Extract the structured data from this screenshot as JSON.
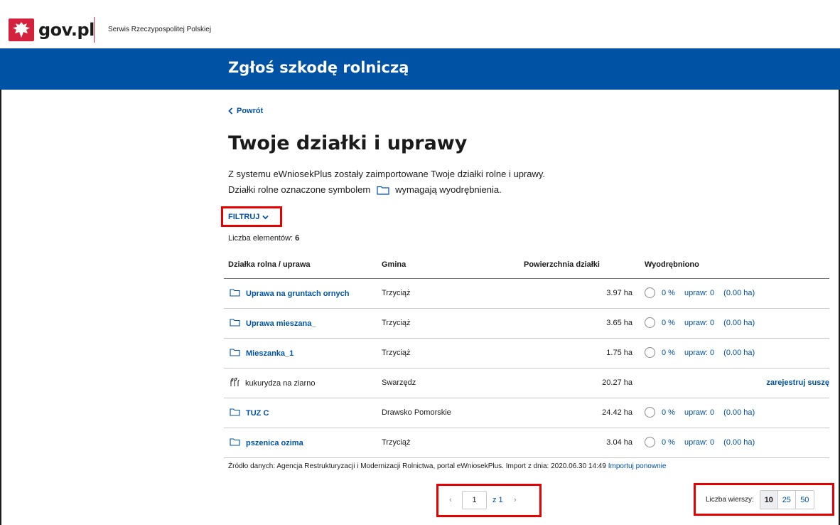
{
  "header": {
    "logo_text": "gov.pl",
    "service_name": "Serwis Rzeczypospolitej Polskiej",
    "banner_title": "Zgłoś szkodę rolniczą"
  },
  "page": {
    "back_label": "Powrót",
    "title": "Twoje działki i uprawy",
    "description_line1": "Z systemu eWniosekPlus zostały zaimportowane Twoje działki rolne i uprawy.",
    "description_line2_before": "Działki rolne oznaczone symbolem",
    "description_line2_after": "wymagają wyodrębnienia.",
    "filter_label": "FILTRUJ",
    "count_label": "Liczba elementów:",
    "count_value": "6"
  },
  "table": {
    "headers": [
      "Działka rolna / uprawa",
      "Gmina",
      "Powierzchnia działki",
      "Wyodrębniono"
    ],
    "rows": [
      {
        "name": "Uprawa na gruntach ornych",
        "icon": "folder-icon",
        "gmina": "Trzyciąż",
        "area": "3.97 ha",
        "pct": "0 %",
        "upraw": "upraw: 0",
        "ha": "(0.00 ha)"
      },
      {
        "name": "Uprawa mieszana_",
        "icon": "folder-icon",
        "gmina": "Trzyciąż",
        "area": "3.65 ha",
        "pct": "0 %",
        "upraw": "upraw: 0",
        "ha": "(0.00 ha)"
      },
      {
        "name": "Mieszanka_1",
        "icon": "folder-icon",
        "gmina": "Trzyciąż",
        "area": "1.75 ha",
        "pct": "0 %",
        "upraw": "upraw: 0",
        "ha": "(0.00 ha)"
      },
      {
        "name": "kukurydza na ziarno",
        "icon": "crop-icon",
        "gmina": "Swarzędz",
        "area": "20.27 ha",
        "link": "zarejestruj suszę"
      },
      {
        "name": "TUZ C",
        "icon": "folder-icon",
        "gmina": "Drawsko Pomorskie",
        "area": "24.42 ha",
        "pct": "0 %",
        "upraw": "upraw: 0",
        "ha": "(0.00 ha)"
      },
      {
        "name": "pszenica ozima",
        "icon": "folder-icon",
        "gmina": "Trzyciąż",
        "area": "3.04 ha",
        "pct": "0 %",
        "upraw": "upraw: 0",
        "ha": "(0.00 ha)"
      }
    ]
  },
  "footer": {
    "source_text": "Źródło danych: Agencja Restrukturyzacji i Modernizacji Rolnictwa, portal eWniosekPlus. Import z dnia: 2020.06.30 14:49",
    "reimport_label": "Importuj ponownie"
  },
  "pagination": {
    "prev": "‹",
    "current_page": "1",
    "of_label": "z 1",
    "next": "›"
  },
  "rows_per_page": {
    "label": "Liczba wierszy:",
    "options": [
      "10",
      "25",
      "50"
    ],
    "selected": "10"
  },
  "colors": {
    "primary": "#0052a5",
    "highlight": "#e60000",
    "brand_red": "#d4213d"
  }
}
